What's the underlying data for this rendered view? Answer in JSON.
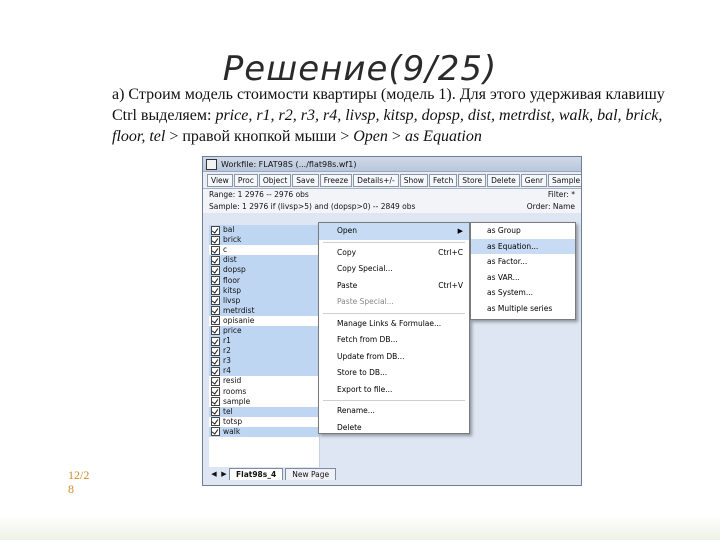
{
  "slide": {
    "title": "Решение(9/25)",
    "text_parts": {
      "p1": "а) Строим модель стоимости квартиры (модель 1). Для этого удерживая клавишу Ctrl выделяем: ",
      "vars": "price, r1, r2, r3, r4, livsp, kitsp, dopsp, dist, metrdist, walk,  bal, brick, floor, tel",
      "p2": " > правой кнопкой мыши > ",
      "open": "Open",
      "p3": " > ",
      "as_eq": "as Equation"
    },
    "page_number": "12/28"
  },
  "window": {
    "title": "Workfile: FLAT98S (.../flat98s.wf1)",
    "toolbar": [
      "View",
      "Proc",
      "Object",
      "Save",
      "Freeze",
      "Details+/-",
      "Show",
      "Fetch",
      "Store",
      "Delete",
      "Genr",
      "Sample"
    ],
    "range_text": "Range:  1 2976  --  2976 obs",
    "filter_text": "Filter: *",
    "sample_text": "Sample: 1 2976 if (livsp>5) and (dopsp>0)  --  2849 obs",
    "order_text": "Order: Name",
    "objects": [
      {
        "name": "bal",
        "selected": true
      },
      {
        "name": "brick",
        "selected": true
      },
      {
        "name": "c",
        "selected": false
      },
      {
        "name": "dist",
        "selected": true
      },
      {
        "name": "dopsp",
        "selected": true
      },
      {
        "name": "floor",
        "selected": true
      },
      {
        "name": "kitsp",
        "selected": true
      },
      {
        "name": "livsp",
        "selected": true
      },
      {
        "name": "metrdist",
        "selected": true
      },
      {
        "name": "opisanie",
        "selected": false
      },
      {
        "name": "price",
        "selected": true
      },
      {
        "name": "r1",
        "selected": true
      },
      {
        "name": "r2",
        "selected": true
      },
      {
        "name": "r3",
        "selected": true
      },
      {
        "name": "r4",
        "selected": true
      },
      {
        "name": "resid",
        "selected": false
      },
      {
        "name": "rooms",
        "selected": false
      },
      {
        "name": "sample",
        "selected": false
      },
      {
        "name": "tel",
        "selected": true
      },
      {
        "name": "totsp",
        "selected": false
      },
      {
        "name": "walk",
        "selected": true
      }
    ],
    "tabs": [
      "Flat98s_4",
      "New Page"
    ]
  },
  "context_menu": {
    "items": [
      {
        "label": "Open",
        "shortcut": "",
        "submenu": true,
        "highlight": true,
        "disabled": false
      },
      {
        "sep": true
      },
      {
        "label": "Copy",
        "shortcut": "Ctrl+C",
        "submenu": false,
        "highlight": false,
        "disabled": false
      },
      {
        "label": "Copy Special...",
        "shortcut": "",
        "submenu": false,
        "highlight": false,
        "disabled": false
      },
      {
        "label": "Paste",
        "shortcut": "Ctrl+V",
        "submenu": false,
        "highlight": false,
        "disabled": false
      },
      {
        "label": "Paste Special...",
        "shortcut": "",
        "submenu": false,
        "highlight": false,
        "disabled": true
      },
      {
        "sep": true
      },
      {
        "label": "Manage Links & Formulae...",
        "shortcut": "",
        "submenu": false,
        "highlight": false,
        "disabled": false
      },
      {
        "label": "Fetch from DB...",
        "shortcut": "",
        "submenu": false,
        "highlight": false,
        "disabled": false
      },
      {
        "label": "Update from DB...",
        "shortcut": "",
        "submenu": false,
        "highlight": false,
        "disabled": false
      },
      {
        "label": "Store to DB...",
        "shortcut": "",
        "submenu": false,
        "highlight": false,
        "disabled": false
      },
      {
        "label": "Export to file...",
        "shortcut": "",
        "submenu": false,
        "highlight": false,
        "disabled": false
      },
      {
        "sep": true
      },
      {
        "label": "Rename...",
        "shortcut": "",
        "submenu": false,
        "highlight": false,
        "disabled": false
      },
      {
        "label": "Delete",
        "shortcut": "",
        "submenu": false,
        "highlight": false,
        "disabled": false
      }
    ]
  },
  "open_submenu": {
    "items": [
      {
        "label": "as Group",
        "highlight": false
      },
      {
        "label": "as Equation...",
        "highlight": true
      },
      {
        "label": "as Factor...",
        "highlight": false
      },
      {
        "label": "as VAR...",
        "highlight": false
      },
      {
        "label": "as System...",
        "highlight": false
      },
      {
        "label": "as Multiple series",
        "highlight": false
      }
    ]
  },
  "colors": {
    "title": "#2a2a2a",
    "page_number": "#d08a2a",
    "selection": "#bfd6f2",
    "menu_highlight": "#c7dcf4"
  }
}
